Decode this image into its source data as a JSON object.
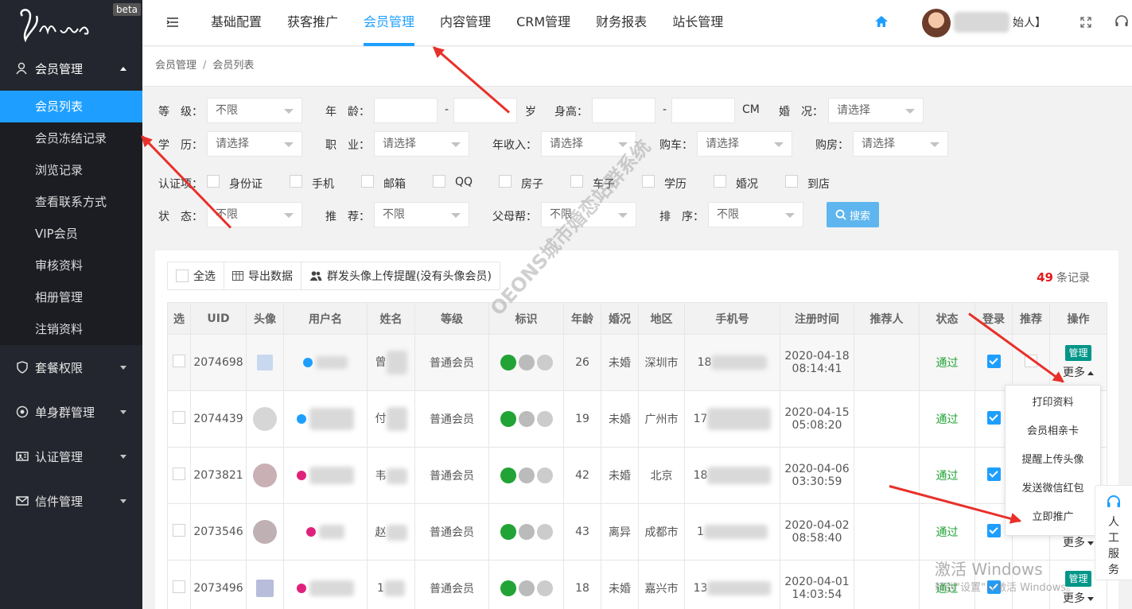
{
  "brand": {
    "beta": "beta"
  },
  "sidebar": {
    "groups": [
      {
        "label": "会员管理",
        "icon": "member-icon"
      },
      {
        "label": "套餐权限",
        "icon": "shield-icon"
      },
      {
        "label": "单身群管理",
        "icon": "target-icon"
      },
      {
        "label": "认证管理",
        "icon": "id-card-icon"
      },
      {
        "label": "信件管理",
        "icon": "mail-icon"
      }
    ],
    "items": [
      "会员列表",
      "会员冻结记录",
      "浏览记录",
      "查看联系方式",
      "VIP会员",
      "审核资料",
      "相册管理",
      "注销资料"
    ]
  },
  "topnav": {
    "items": [
      "基础配置",
      "获客推广",
      "会员管理",
      "内容管理",
      "CRM管理",
      "财务报表",
      "站长管理"
    ],
    "user_suffix": "始人】"
  },
  "breadcrumb": {
    "root": "会员管理",
    "sep": "/",
    "current": "会员列表"
  },
  "filters": {
    "grade_label": "等　级：",
    "grade_value": "不限",
    "age_label": "年　龄：",
    "age_dash": "-",
    "age_unit": "岁",
    "height_label": "身高：",
    "height_dash": "-",
    "height_unit": "CM",
    "marriage_label": "婚　况：",
    "marriage_placeholder": "请选择",
    "edu_label": "学　历：",
    "edu_placeholder": "请选择",
    "job_label": "职　业：",
    "job_placeholder": "请选择",
    "income_label": "年收入：",
    "income_placeholder": "请选择",
    "car_label": "购车：",
    "car_placeholder": "请选择",
    "house_label": "购房：",
    "house_placeholder": "请选择",
    "cert_label": "认证项：",
    "cert_items": [
      "身份证",
      "手机",
      "邮箱",
      "QQ",
      "房子",
      "车子",
      "学历",
      "婚况",
      "到店"
    ],
    "status_label": "状　态：",
    "status_value": "不限",
    "recommend_label": "推　荐：",
    "recommend_value": "不限",
    "parent_label": "父母帮：",
    "parent_value": "不限",
    "sort_label": "排　序：",
    "sort_value": "不限",
    "search_button": "搜索"
  },
  "toolbar": {
    "select_all": "全选",
    "export": "导出数据",
    "remind": "群发头像上传提醒(没有头像会员)"
  },
  "record_count": {
    "number": "49",
    "unit": "条记录"
  },
  "table": {
    "headers": [
      "选",
      "UID",
      "头像",
      "用户名",
      "姓名",
      "等级",
      "标识",
      "年龄",
      "婚况",
      "地区",
      "手机号",
      "注册时间",
      "推荐人",
      "状态",
      "登录",
      "推荐",
      "操作"
    ],
    "rows": [
      {
        "uid": "2074698",
        "name_char": "曾",
        "level": "普通会员",
        "age": "26",
        "marriage": "未婚",
        "region": "深圳市",
        "phone_prefix": "18",
        "reg_date": "2020-04-18",
        "reg_time": "08:14:41",
        "status": "通过"
      },
      {
        "uid": "2074439",
        "name_char": "付",
        "level": "普通会员",
        "age": "19",
        "marriage": "未婚",
        "region": "广州市",
        "phone_prefix": "17",
        "reg_date": "2020-04-15",
        "reg_time": "05:08:20",
        "status": "通过"
      },
      {
        "uid": "2073821",
        "name_char": "韦",
        "level": "普通会员",
        "age": "42",
        "marriage": "未婚",
        "region": "北京",
        "phone_prefix": "18",
        "reg_date": "2020-04-06",
        "reg_time": "03:30:59",
        "status": "通过"
      },
      {
        "uid": "2073546",
        "name_char": "赵",
        "level": "普通会员",
        "age": "43",
        "marriage": "离异",
        "region": "成都市",
        "phone_prefix": "1",
        "reg_date": "2020-04-02",
        "reg_time": "08:58:40",
        "status": "通过"
      },
      {
        "uid": "2073496",
        "name_char": "1",
        "level": "普通会员",
        "age": "18",
        "marriage": "未婚",
        "region": "嘉兴市",
        "phone_prefix": "13",
        "reg_date": "2020-04-01",
        "reg_time": "14:03:54",
        "status": "通过"
      }
    ],
    "manage_tag": "管理",
    "more_label": "更多"
  },
  "dropdown": {
    "items": [
      "打印资料",
      "会员相亲卡",
      "提醒上传头像",
      "发送微信红包",
      "立即推广"
    ]
  },
  "watermark": "OEONS城市婚恋站群系统",
  "windows": {
    "line1": "激活 Windows",
    "line2": "转到\"设置\"以激活 Windows。"
  },
  "service": {
    "label": "人工服务"
  },
  "colors": {
    "accent": "#1e9fff",
    "sidebar": "#23262e",
    "success": "#22a336",
    "count": "#e41b1b",
    "tag": "#009688",
    "arrow": "#e8302a"
  }
}
